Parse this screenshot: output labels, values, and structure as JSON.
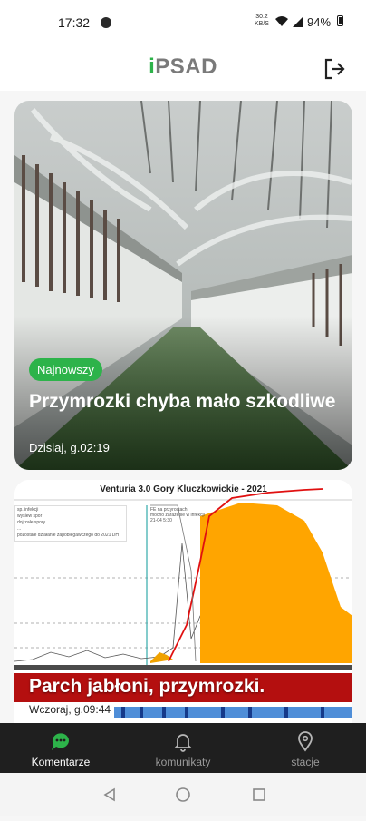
{
  "status": {
    "time": "17:32",
    "speed_value": "30.2",
    "speed_unit": "KB/S",
    "battery": "94%"
  },
  "header": {
    "logo_prefix": "i",
    "logo_main": "PSAD"
  },
  "cards": [
    {
      "badge": "Najnowszy",
      "title": "Przymrozki chyba mało szkodliwe",
      "date": "Dzisiaj, g.02:19"
    },
    {
      "title": "Parch jabłoni, przymrozki.",
      "date": "Wczoraj, g.09:44",
      "chart_title": "Venturia 3.0  Gory Kluczkowickie - 2021",
      "chart_legend": [
        "sp. infekcji",
        "wysiew spor",
        "dojrzałe spory",
        "...",
        "pozostałe działanie zapobiegawczego do 2021 DH"
      ],
      "chart_note": "FE na przyrostach\nmocno zarażenie w infekcji\n21-04 5:30"
    }
  ],
  "nav": [
    {
      "label": "Komentarze",
      "active": true
    },
    {
      "label": "komunikaty",
      "active": false
    },
    {
      "label": "stacje",
      "active": false
    }
  ],
  "colors": {
    "accent": "#2db34a",
    "nav_bg": "#1f1f1f",
    "nav_inactive": "#9a9a9a"
  }
}
